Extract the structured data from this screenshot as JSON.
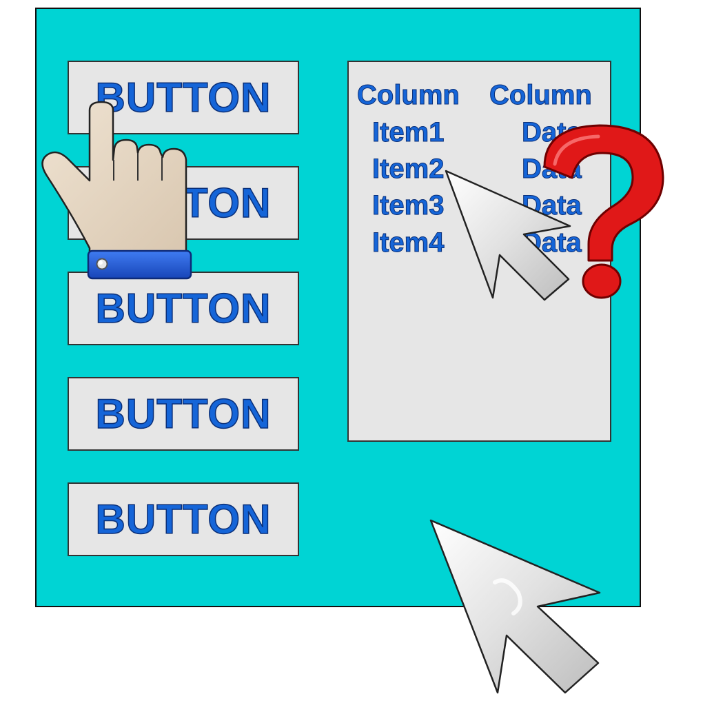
{
  "buttons": [
    {
      "label": "BUTTON"
    },
    {
      "label": "BUTTON"
    },
    {
      "label": "BUTTON"
    },
    {
      "label": "BUTTON"
    },
    {
      "label": "BUTTON"
    }
  ],
  "table": {
    "headers": [
      "Column",
      "Column"
    ],
    "rows": [
      [
        "Item1",
        "Data"
      ],
      [
        "Item2",
        "Data"
      ],
      [
        "Item3",
        "Data"
      ],
      [
        "Item4",
        "Data"
      ]
    ]
  },
  "overlay_icons": [
    "pointing-hand-icon",
    "arrow-cursor-icon",
    "question-mark-icon",
    "arrow-cursor-icon"
  ],
  "colors": {
    "window_bg": "#00d4d4",
    "control_bg": "#e6e6e6",
    "text_blue": "#1565d8",
    "question_red": "#e01818",
    "cuff_blue": "#1e56d8"
  }
}
